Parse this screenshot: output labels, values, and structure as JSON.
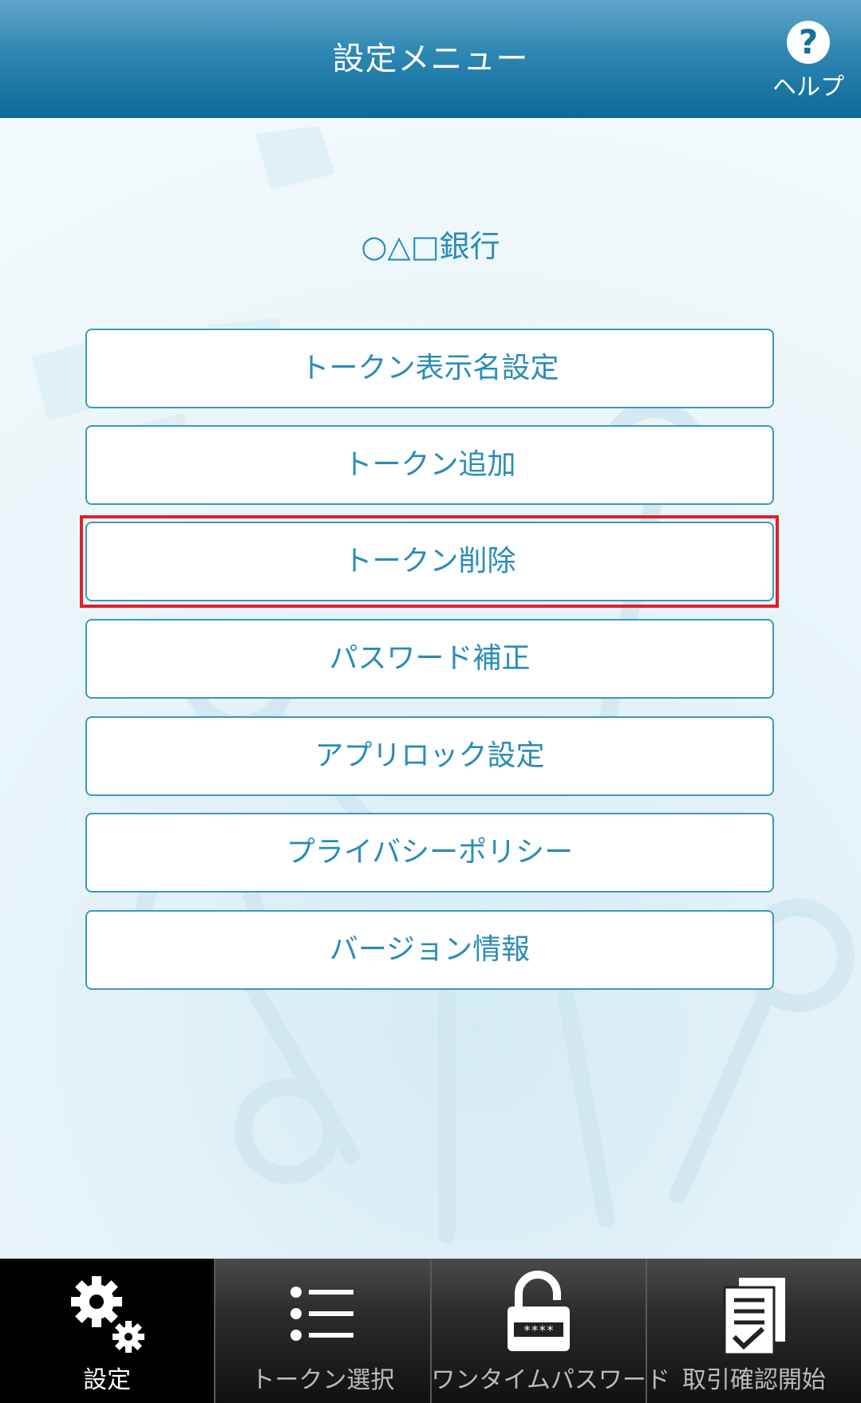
{
  "header": {
    "title": "設定メニュー",
    "help_label": "ヘルプ",
    "help_glyph": "?"
  },
  "bank_name": "○△□銀行",
  "menu": {
    "items": [
      {
        "label": "トークン表示名設定"
      },
      {
        "label": "トークン追加"
      },
      {
        "label": "トークン削除",
        "highlighted": true
      },
      {
        "label": "パスワード補正"
      },
      {
        "label": "アプリロック設定"
      },
      {
        "label": "プライバシーポリシー"
      },
      {
        "label": "バージョン情報"
      }
    ]
  },
  "tabbar": {
    "tabs": [
      {
        "label": "設定",
        "icon": "gears-icon",
        "active": true
      },
      {
        "label": "トークン選択",
        "icon": "list-icon"
      },
      {
        "label": "ワンタイムパスワード",
        "icon": "lock-icon",
        "pin_mask": "****"
      },
      {
        "label": "取引確認開始",
        "icon": "document-check-icon"
      }
    ]
  },
  "colors": {
    "accent": "#2a8db6",
    "header": "#0d6a98",
    "highlight": "#e0202a",
    "tabbar": "#1a1a1a"
  }
}
